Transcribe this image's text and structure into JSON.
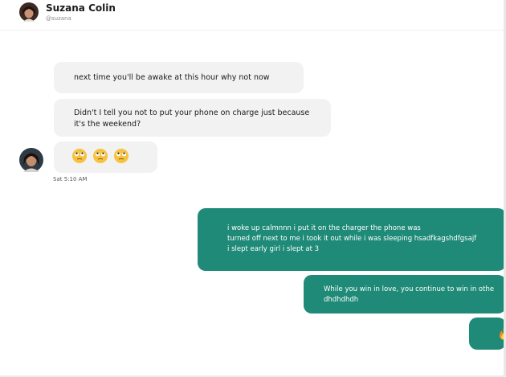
{
  "header": {
    "name": "Suzana Colin",
    "handle": "@suzana"
  },
  "messages": {
    "incoming": [
      {
        "text": "next time you'll be awake at this hour why not now"
      },
      {
        "text": "Didn't I tell you not to put your phone on charge just because it's the weekend?"
      },
      {
        "emojis": [
          "face-with-rolling-eyes",
          "face-with-rolling-eyes",
          "face-with-rolling-eyes"
        ]
      }
    ],
    "timestamp": "Sat 5:10 AM",
    "outgoing": [
      {
        "lines": [
          "i woke up calmnnn i put it on the charger the phone was",
          "turned off next to me i took it out while i was sleeping hsadfkagshdfgsajf",
          "i slept early girl i slept at 3"
        ]
      },
      {
        "lines": [
          "While you win in love, you continue to win in othe",
          "dhdhdhdh"
        ]
      },
      {
        "emoji": "fire"
      }
    ]
  },
  "colors": {
    "incoming_bubble": "#f2f2f2",
    "outgoing_bubble": "#1f8a78",
    "timestamp": "#5a5a5a"
  }
}
